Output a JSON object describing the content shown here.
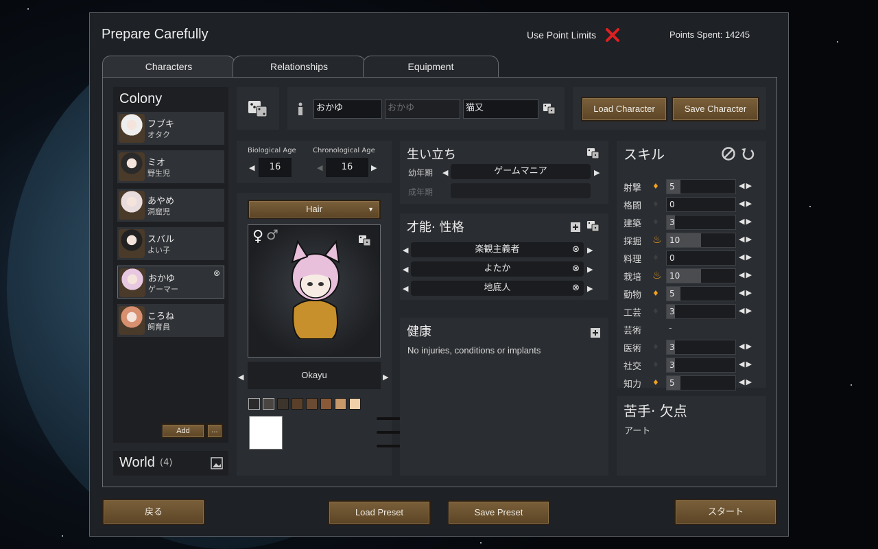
{
  "header": {
    "title": "Prepare Carefully",
    "point_limits_label": "Use Point Limits",
    "points_spent": "Points Spent: 14245"
  },
  "tabs": [
    "Characters",
    "Relationships",
    "Equipment"
  ],
  "colony": {
    "title": "Colony",
    "pawns": [
      {
        "name": "フブキ",
        "title": "オタク",
        "hair": "#eeeeee"
      },
      {
        "name": "ミオ",
        "title": "野生児",
        "hair": "#2a2a2a"
      },
      {
        "name": "あやめ",
        "title": "洞窟児",
        "hair": "#e8dcdc"
      },
      {
        "name": "スバル",
        "title": "よい子",
        "hair": "#222222"
      },
      {
        "name": "おかゆ",
        "title": "ゲーマー",
        "hair": "#e8c8e0"
      },
      {
        "name": "ころね",
        "title": "飼育員",
        "hair": "#d89070"
      }
    ],
    "add_label": "Add",
    "more_label": "...",
    "world_label": "World",
    "world_count": "(4)"
  },
  "names": {
    "first": "おかゆ",
    "nick_placeholder": "おかゆ",
    "last": "猫又"
  },
  "buttons": {
    "load_character": "Load Character",
    "save_character": "Save Character",
    "back": "戻る",
    "load_preset": "Load Preset",
    "save_preset": "Save Preset",
    "start": "スタート"
  },
  "age": {
    "bio_label": "Biological Age",
    "bio_value": "16",
    "chrono_label": "Chronological Age",
    "chrono_value": "16"
  },
  "appearance": {
    "dropdown": "Hair",
    "gender_female": "♀",
    "gender_male": "♂",
    "pawn_name": "Okayu",
    "skin_colors": [
      "#2b2b2b",
      "#4a4540",
      "#3d342c",
      "#5a4028",
      "#6a4a30",
      "#8a5a38",
      "#c89868",
      "#f0d0a8"
    ],
    "selected_color": "#ffffff",
    "slider_colors": [
      "#c81818",
      "#18a818",
      "#1828c8"
    ]
  },
  "backstory": {
    "title": "生い立ち",
    "childhood_label": "幼年期",
    "childhood_value": "ゲームマニア",
    "adulthood_label": "成年期"
  },
  "traits": {
    "title": "才能· 性格",
    "items": [
      "楽観主義者",
      "よたか",
      "地底人"
    ]
  },
  "health": {
    "title": "健康",
    "text": "No injuries, conditions or implants"
  },
  "skills": {
    "title": "スキル",
    "items": [
      {
        "label": "射撃",
        "value": "5",
        "passion": 1,
        "level": 0.2
      },
      {
        "label": "格闘",
        "value": "0",
        "passion": 0,
        "level": 0
      },
      {
        "label": "建築",
        "value": "3",
        "passion": 0,
        "level": 0.12
      },
      {
        "label": "採掘",
        "value": "10",
        "passion": 2,
        "level": 0.5
      },
      {
        "label": "料理",
        "value": "0",
        "passion": 0,
        "level": 0
      },
      {
        "label": "栽培",
        "value": "10",
        "passion": 2,
        "level": 0.5
      },
      {
        "label": "動物",
        "value": "5",
        "passion": 1,
        "level": 0.2
      },
      {
        "label": "工芸",
        "value": "3",
        "passion": 0,
        "level": 0.12
      },
      {
        "label": "芸術",
        "value": "-",
        "passion": -1,
        "level": 0
      },
      {
        "label": "医術",
        "value": "3",
        "passion": 0,
        "level": 0.12
      },
      {
        "label": "社交",
        "value": "3",
        "passion": 0,
        "level": 0.12
      },
      {
        "label": "知力",
        "value": "5",
        "passion": 1,
        "level": 0.2
      }
    ]
  },
  "incapable": {
    "title": "苦手· 欠点",
    "text": "アート"
  }
}
